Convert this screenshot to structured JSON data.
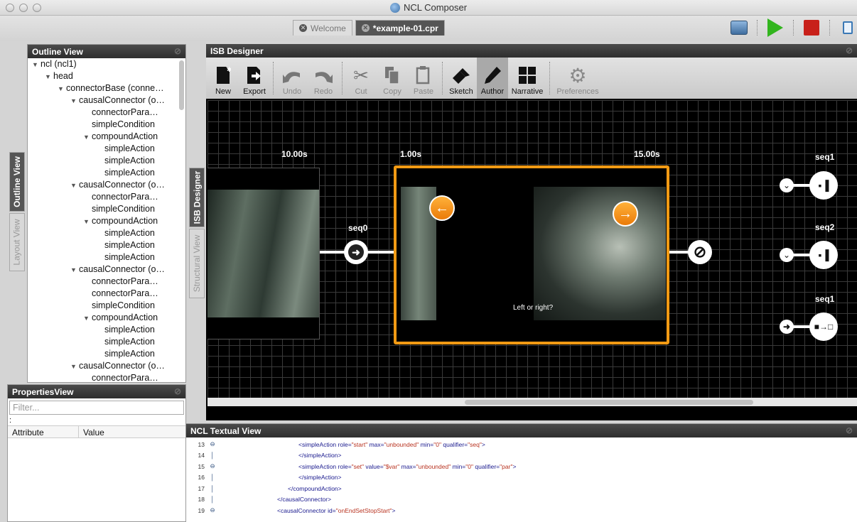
{
  "window": {
    "title": "NCL Composer"
  },
  "doc_tabs": [
    {
      "label": "Welcome"
    },
    {
      "label": "*example-01.cpr"
    }
  ],
  "side_tabs": {
    "left": [
      "Outline View",
      "Layout View"
    ],
    "middle": [
      "ISB Designer",
      "Structural View"
    ]
  },
  "outline": {
    "title": "Outline View",
    "items": [
      {
        "label": "ncl (ncl1)",
        "level": 0,
        "expanded": true
      },
      {
        "label": "head",
        "level": 1,
        "expanded": true
      },
      {
        "label": "connectorBase (conne…",
        "level": 2,
        "expanded": true
      },
      {
        "label": "causalConnector (o…",
        "level": 3,
        "expanded": true
      },
      {
        "label": "connectorPara…",
        "level": 4
      },
      {
        "label": "simpleCondition",
        "level": 4
      },
      {
        "label": "compoundAction",
        "level": 4,
        "expanded": true
      },
      {
        "label": "simpleAction",
        "level": 5
      },
      {
        "label": "simpleAction",
        "level": 5
      },
      {
        "label": "simpleAction",
        "level": 5
      },
      {
        "label": "causalConnector (o…",
        "level": 3,
        "expanded": true
      },
      {
        "label": "connectorPara…",
        "level": 4
      },
      {
        "label": "simpleCondition",
        "level": 4
      },
      {
        "label": "compoundAction",
        "level": 4,
        "expanded": true
      },
      {
        "label": "simpleAction",
        "level": 5
      },
      {
        "label": "simpleAction",
        "level": 5
      },
      {
        "label": "simpleAction",
        "level": 5
      },
      {
        "label": "causalConnector (o…",
        "level": 3,
        "expanded": true
      },
      {
        "label": "connectorPara…",
        "level": 4
      },
      {
        "label": "connectorPara…",
        "level": 4
      },
      {
        "label": "simpleCondition",
        "level": 4
      },
      {
        "label": "compoundAction",
        "level": 4,
        "expanded": true
      },
      {
        "label": "simpleAction",
        "level": 5
      },
      {
        "label": "simpleAction",
        "level": 5
      },
      {
        "label": "simpleAction",
        "level": 5
      },
      {
        "label": "causalConnector (o…",
        "level": 3,
        "expanded": true
      },
      {
        "label": "connectorPara…",
        "level": 4
      }
    ]
  },
  "properties": {
    "title": "PropertiesView",
    "filter_placeholder": "Filter...",
    "path": ":",
    "columns": [
      "Attribute",
      "Value"
    ]
  },
  "isb": {
    "title": "ISB Designer",
    "toolbar": {
      "new": "New",
      "export": "Export",
      "undo": "Undo",
      "redo": "Redo",
      "cut": "Cut",
      "copy": "Copy",
      "paste": "Paste",
      "sketch": "Sketch",
      "author": "Author",
      "narrative": "Narrative",
      "preferences": "Preferences"
    },
    "durations": {
      "first": "10.00s",
      "second": "1.00s",
      "third": "15.00s"
    },
    "links": {
      "seq0": "seq0"
    },
    "scene_caption": "Left or right?",
    "endpoints": [
      {
        "label": "seq1"
      },
      {
        "label": "seq2"
      },
      {
        "label": "seq1"
      }
    ]
  },
  "text_view": {
    "title": "NCL Textual View",
    "lines": [
      {
        "num": "13",
        "indent": 110,
        "parts": [
          [
            "tag",
            "<simpleAction "
          ],
          [
            "att",
            "role="
          ],
          [
            "val",
            "\"start\""
          ],
          [
            "att",
            " max="
          ],
          [
            "val",
            "\"unbounded\""
          ],
          [
            "att",
            " min="
          ],
          [
            "val",
            "\"0\""
          ],
          [
            "att",
            " qualifier="
          ],
          [
            "val",
            "\"seq\""
          ],
          [
            "tag",
            ">"
          ]
        ]
      },
      {
        "num": "14",
        "indent": 110,
        "parts": [
          [
            "tag",
            "</simpleAction>"
          ]
        ]
      },
      {
        "num": "15",
        "indent": 110,
        "parts": [
          [
            "tag",
            "<simpleAction "
          ],
          [
            "att",
            "role="
          ],
          [
            "val",
            "\"set\""
          ],
          [
            "att",
            " value="
          ],
          [
            "val",
            "\"$var\""
          ],
          [
            "att",
            " max="
          ],
          [
            "val",
            "\"unbounded\""
          ],
          [
            "att",
            " min="
          ],
          [
            "val",
            "\"0\""
          ],
          [
            "att",
            " qualifier="
          ],
          [
            "val",
            "\"par\""
          ],
          [
            "tag",
            ">"
          ]
        ]
      },
      {
        "num": "16",
        "indent": 110,
        "parts": [
          [
            "tag",
            "</simpleAction>"
          ]
        ]
      },
      {
        "num": "17",
        "indent": 95,
        "parts": [
          [
            "tag",
            "</compoundAction>"
          ]
        ]
      },
      {
        "num": "18",
        "indent": 80,
        "parts": [
          [
            "tag",
            "</causalConnector>"
          ]
        ]
      },
      {
        "num": "19",
        "indent": 80,
        "parts": [
          [
            "tag",
            "<causalConnector "
          ],
          [
            "att",
            "id="
          ],
          [
            "val",
            "\"onEndSetStopStart\""
          ],
          [
            "tag",
            ">"
          ]
        ]
      }
    ]
  }
}
